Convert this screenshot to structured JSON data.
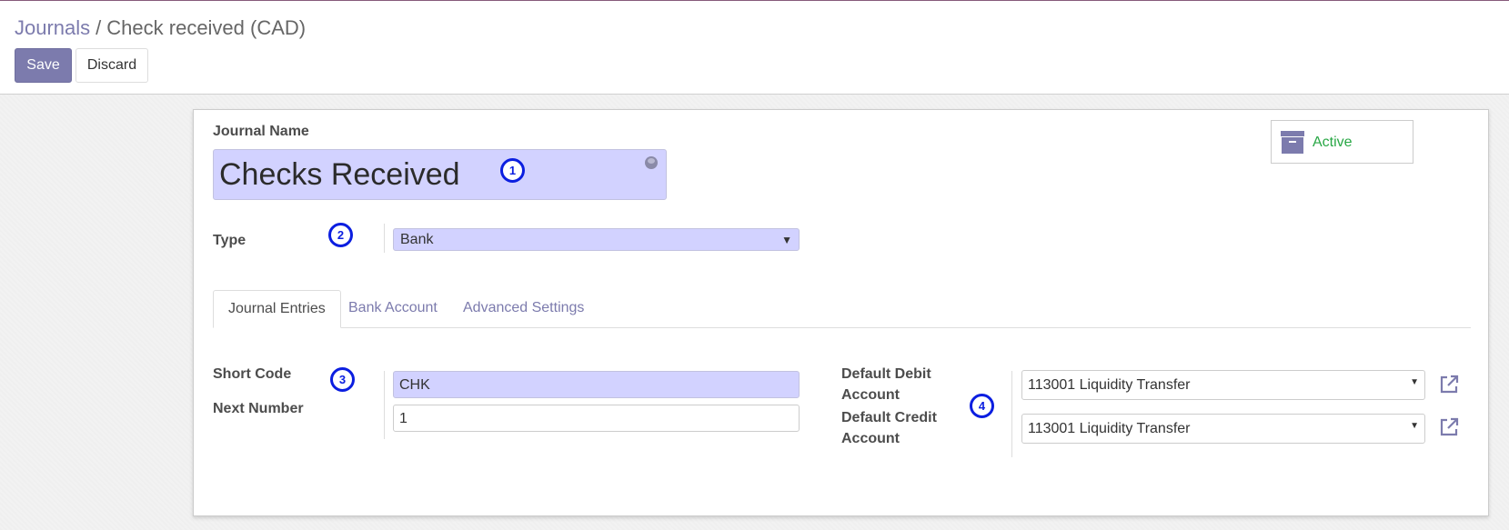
{
  "breadcrumb": {
    "parent": "Journals",
    "separator": "/",
    "current": "Check received (CAD)"
  },
  "toolbar": {
    "save_label": "Save",
    "discard_label": "Discard"
  },
  "form": {
    "journal_name_label": "Journal Name",
    "journal_name_value": "Checks Received",
    "type_label": "Type",
    "type_value": "Bank",
    "status_button": {
      "label": "Active",
      "color": "#28a745"
    }
  },
  "tabs": [
    {
      "label": "Journal Entries",
      "active": true
    },
    {
      "label": "Bank Account",
      "active": false
    },
    {
      "label": "Advanced Settings",
      "active": false
    }
  ],
  "journal_entries": {
    "short_code_label": "Short Code",
    "short_code_value": "CHK",
    "next_number_label": "Next Number",
    "next_number_value": "1",
    "default_debit_label_line1": "Default Debit",
    "default_debit_label_line2": "Account",
    "default_debit_value": "113001 Liquidity Transfer",
    "default_credit_label_line1": "Default Credit",
    "default_credit_label_line2": "Account",
    "default_credit_value": "113001 Liquidity Transfer"
  },
  "annotations": {
    "m1": "1",
    "m2": "2",
    "m3": "3",
    "m4": "4"
  },
  "colors": {
    "primary": "#7c7bad",
    "required_field_bg": "#d2d2ff",
    "marker": "#0b1ee0",
    "active_green": "#28a745"
  },
  "icons": [
    "globe-icon",
    "archive-icon",
    "external-link-icon",
    "caret-down-icon"
  ]
}
